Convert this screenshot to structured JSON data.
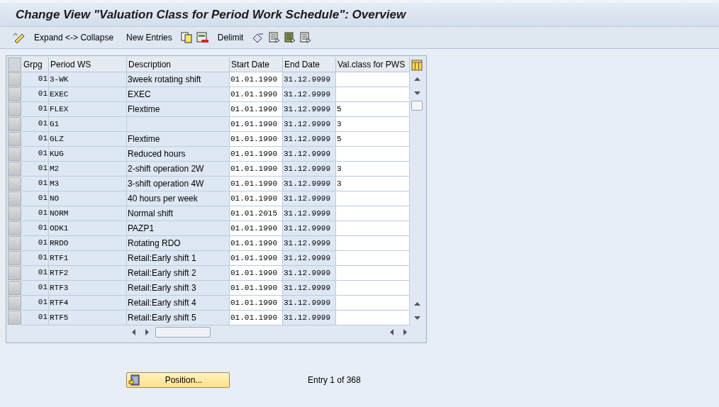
{
  "window": {
    "title": "Change View \"Valuation Class for Period Work Schedule\": Overview"
  },
  "toolbar": {
    "buttons": [
      "Expand <-> Collapse",
      "New Entries",
      "Delimit"
    ]
  },
  "table": {
    "columns": [
      "Grpg",
      "Period WS",
      "Description",
      "Start Date",
      "End Date",
      "Val.class for PWS"
    ],
    "rows": [
      {
        "grpg": "01",
        "period_ws": "3-WK",
        "description": "3week rotating shift",
        "start_date": "01.01.1990",
        "end_date": "31.12.9999",
        "val_class": ""
      },
      {
        "grpg": "01",
        "period_ws": "EXEC",
        "description": "EXEC",
        "start_date": "01.01.1990",
        "end_date": "31.12.9999",
        "val_class": ""
      },
      {
        "grpg": "01",
        "period_ws": "FLEX",
        "description": "Flextime",
        "start_date": "01.01.1990",
        "end_date": "31.12.9999",
        "val_class": "5"
      },
      {
        "grpg": "01",
        "period_ws": "G1",
        "description": "",
        "start_date": "01.01.1990",
        "end_date": "31.12.9999",
        "val_class": "3"
      },
      {
        "grpg": "01",
        "period_ws": "GLZ",
        "description": "Flextime",
        "start_date": "01.01.1990",
        "end_date": "31.12.9999",
        "val_class": "5"
      },
      {
        "grpg": "01",
        "period_ws": "KUG",
        "description": "Reduced hours",
        "start_date": "01.01.1990",
        "end_date": "31.12.9999",
        "val_class": ""
      },
      {
        "grpg": "01",
        "period_ws": "M2",
        "description": "2-shift operation 2W",
        "start_date": "01.01.1990",
        "end_date": "31.12.9999",
        "val_class": "3"
      },
      {
        "grpg": "01",
        "period_ws": "M3",
        "description": "3-shift operation 4W",
        "start_date": "01.01.1990",
        "end_date": "31.12.9999",
        "val_class": "3"
      },
      {
        "grpg": "01",
        "period_ws": "NO",
        "description": "40 hours per week",
        "start_date": "01.01.1990",
        "end_date": "31.12.9999",
        "val_class": ""
      },
      {
        "grpg": "01",
        "period_ws": "NORM",
        "description": "Normal shift",
        "start_date": "01.01.2015",
        "end_date": "31.12.9999",
        "val_class": ""
      },
      {
        "grpg": "01",
        "period_ws": "ODK1",
        "description": "PAZP1",
        "start_date": "01.01.1990",
        "end_date": "31.12.9999",
        "val_class": ""
      },
      {
        "grpg": "01",
        "period_ws": "RRDO",
        "description": "Rotating RDO",
        "start_date": "01.01.1990",
        "end_date": "31.12.9999",
        "val_class": ""
      },
      {
        "grpg": "01",
        "period_ws": "RTF1",
        "description": "Retail:Early shift 1",
        "start_date": "01.01.1990",
        "end_date": "31.12.9999",
        "val_class": ""
      },
      {
        "grpg": "01",
        "period_ws": "RTF2",
        "description": "Retail:Early shift 2",
        "start_date": "01.01.1990",
        "end_date": "31.12.9999",
        "val_class": ""
      },
      {
        "grpg": "01",
        "period_ws": "RTF3",
        "description": "Retail:Early shift 3",
        "start_date": "01.01.1990",
        "end_date": "31.12.9999",
        "val_class": ""
      },
      {
        "grpg": "01",
        "period_ws": "RTF4",
        "description": "Retail:Early shift 4",
        "start_date": "01.01.1990",
        "end_date": "31.12.9999",
        "val_class": ""
      },
      {
        "grpg": "01",
        "period_ws": "RTF5",
        "description": "Retail:Early shift 5",
        "start_date": "01.01.1990",
        "end_date": "31.12.9999",
        "val_class": ""
      }
    ]
  },
  "position_button": "Position...",
  "entry_info": "Entry 1 of 368"
}
